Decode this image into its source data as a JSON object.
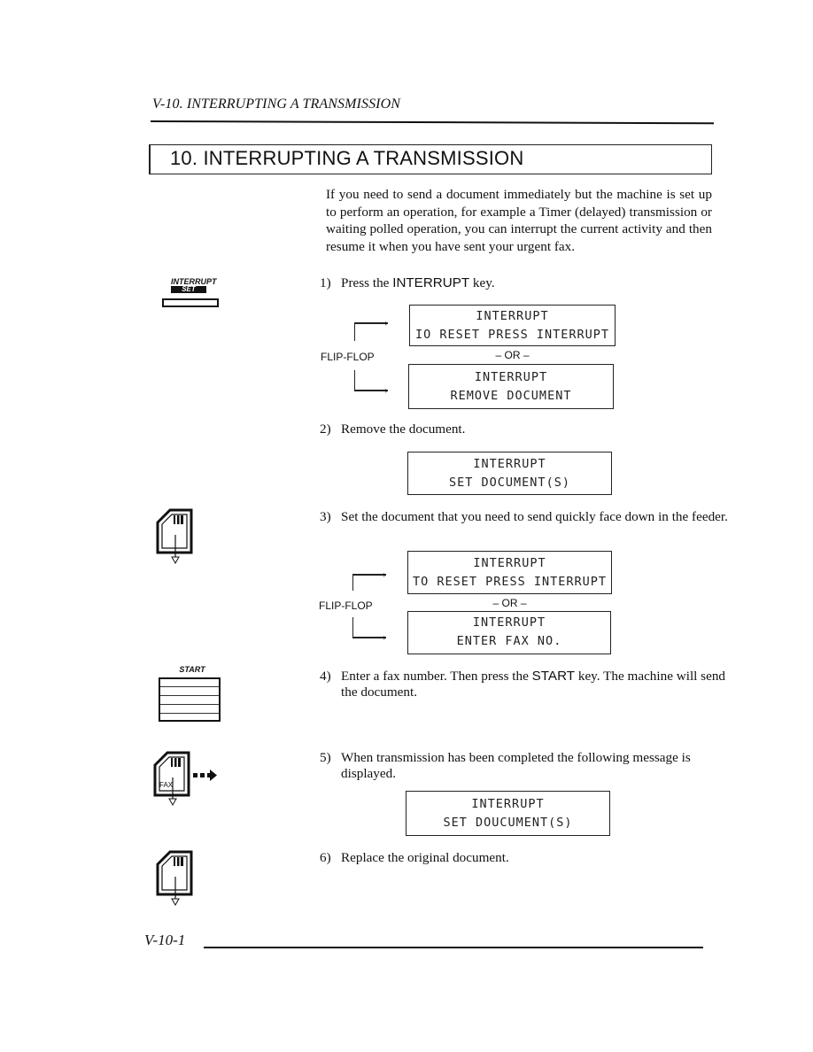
{
  "page": {
    "running_header": "V-10. INTERRUPTING A TRANSMISSION",
    "section_title": "10. INTERRUPTING A TRANSMISSION",
    "intro": "If you need to send a document immediately but the machine is set up to perform an operation, for example a Timer (delayed) transmission or waiting polled operation, you can interrupt the current activity and then resume it when you have sent your urgent fax.",
    "footer_page_number": "V-10-1"
  },
  "side_icons": {
    "interrupt_key": {
      "label": "INTERRUPT",
      "sublabel": "SET",
      "icon": "interrupt-key-icon"
    },
    "document_feed_1": {
      "icon": "document-face-down-icon"
    },
    "start_key": {
      "label": "START",
      "icon": "start-key-icon"
    },
    "fax_send": {
      "label": "FAX",
      "icon": "fax-send-icon"
    },
    "document_feed_2": {
      "icon": "document-face-down-icon"
    }
  },
  "steps": [
    {
      "num": "1)",
      "pre": "Press the ",
      "key": "INTERRUPT",
      "post": " key."
    },
    {
      "num": "2)",
      "text": "Remove the document."
    },
    {
      "num": "3)",
      "text": "Set the document that you need to send quickly face down in the feeder."
    },
    {
      "num": "4)",
      "pre": "Enter a fax number. Then press the ",
      "key": "START",
      "post": " key. The machine will send the document."
    },
    {
      "num": "5)",
      "text": "When transmission has been completed the following message is displayed."
    },
    {
      "num": "6)",
      "text": "Replace the original document."
    }
  ],
  "displays": {
    "flip1": {
      "label": "FLIP-FLOP",
      "or": "– OR –",
      "a": [
        "INTERRUPT",
        "IO RESET PRESS INTERRUPT"
      ],
      "b": [
        "INTERRUPT",
        "REMOVE DOCUMENT"
      ]
    },
    "step2": [
      "INTERRUPT",
      "SET DOCUMENT(S)"
    ],
    "flip2": {
      "label": "FLIP-FLOP",
      "or": "– OR –",
      "a": [
        "INTERRUPT",
        "TO RESET PRESS INTERRUPT"
      ],
      "b": [
        "INTERRUPT",
        "ENTER FAX NO."
      ]
    },
    "step5": [
      "INTERRUPT",
      "SET DOUCUMENT(S)"
    ]
  }
}
